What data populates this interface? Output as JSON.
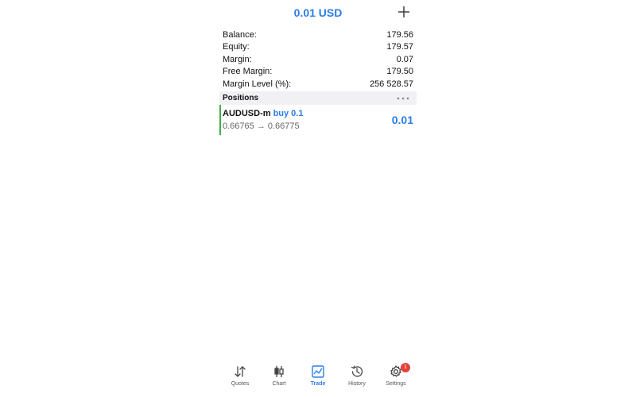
{
  "header": {
    "title": "0.01 USD"
  },
  "summary": [
    {
      "label": "Balance:",
      "value": "179.56"
    },
    {
      "label": "Equity:",
      "value": "179.57"
    },
    {
      "label": "Margin:",
      "value": "0.07"
    },
    {
      "label": "Free Margin:",
      "value": "179.50"
    },
    {
      "label": "Margin Level (%):",
      "value": "256 528.57"
    }
  ],
  "positions_section": {
    "title": "Positions"
  },
  "position": {
    "symbol": "AUDUSD-m",
    "side": "buy 0.1",
    "prices": "0.66765 → 0.66775",
    "profit": "0.01"
  },
  "tabs": [
    {
      "label": "Quotes",
      "icon": "arrows-up-down-icon"
    },
    {
      "label": "Chart",
      "icon": "candlestick-icon"
    },
    {
      "label": "Trade",
      "icon": "trend-chart-icon",
      "active": true
    },
    {
      "label": "History",
      "icon": "history-clock-icon"
    },
    {
      "label": "Settings",
      "icon": "gear-icon",
      "badge": "1"
    }
  ],
  "colors": {
    "accent": "#2b7de9",
    "buy_bar": "#3cb043",
    "badge": "#e5403a"
  }
}
